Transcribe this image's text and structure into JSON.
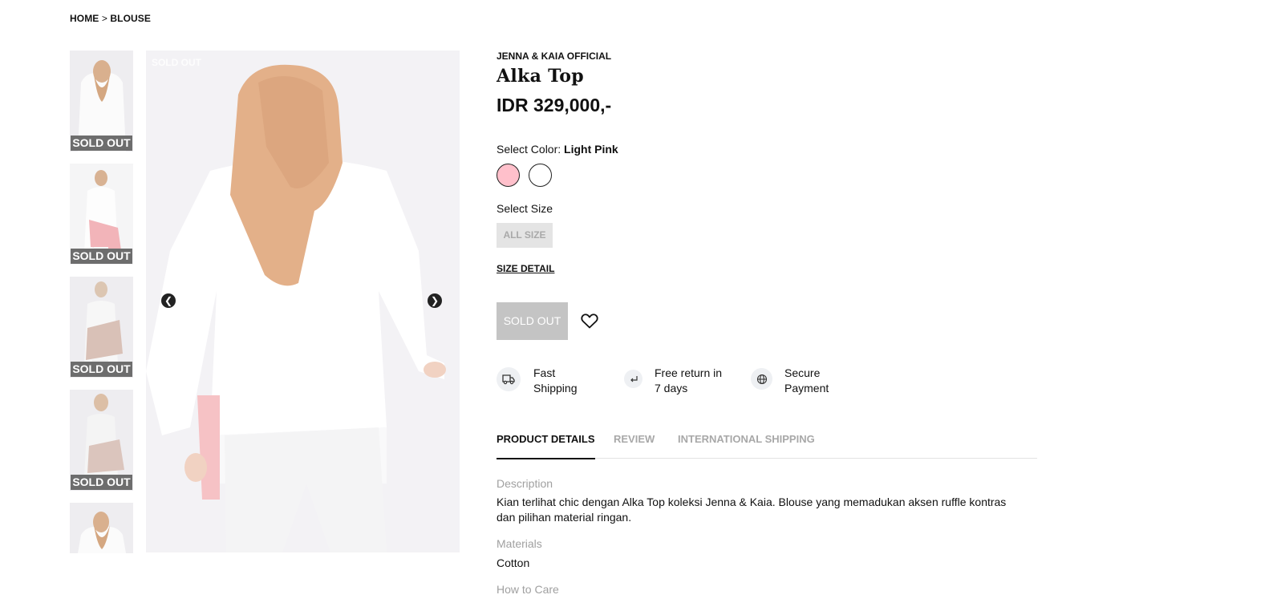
{
  "breadcrumb": {
    "home": "HOME",
    "separator": ">",
    "category": "BLOUSE"
  },
  "gallery": {
    "thumb_badge": "SOLD OUT",
    "main_badge": "SOLD OUT",
    "thumb_count": 5
  },
  "product": {
    "brand": "JENNA & KAIA OFFICIAL",
    "name": "Alka Top",
    "price": "IDR 329,000,-",
    "color_label": "Select Color:",
    "color_value": "Light Pink",
    "colors": [
      {
        "name": "Light Pink",
        "hex": "#ffc0cb"
      },
      {
        "name": "White",
        "hex": "#ffffff"
      }
    ],
    "size_label": "Select Size",
    "size_option": "ALL SIZE",
    "size_detail": "SIZE DETAIL",
    "cta": "SOLD OUT"
  },
  "features": [
    {
      "icon": "truck-icon",
      "line1": "Fast",
      "line2": "Shipping"
    },
    {
      "icon": "return-icon",
      "line1": "Free return in",
      "line2": "7 days"
    },
    {
      "icon": "globe-icon",
      "line1": "Secure",
      "line2": "Payment"
    }
  ],
  "tabs": [
    "PRODUCT DETAILS",
    "REVIEW",
    "INTERNATIONAL SHIPPING"
  ],
  "details": {
    "description_title": "Description",
    "description": "Kian terlihat chic dengan Alka Top koleksi Jenna & Kaia. Blouse yang memadukan aksen ruffle kontras dan pilihan material ringan.",
    "materials_title": "Materials",
    "materials": "Cotton",
    "care_title": "How to Care"
  }
}
